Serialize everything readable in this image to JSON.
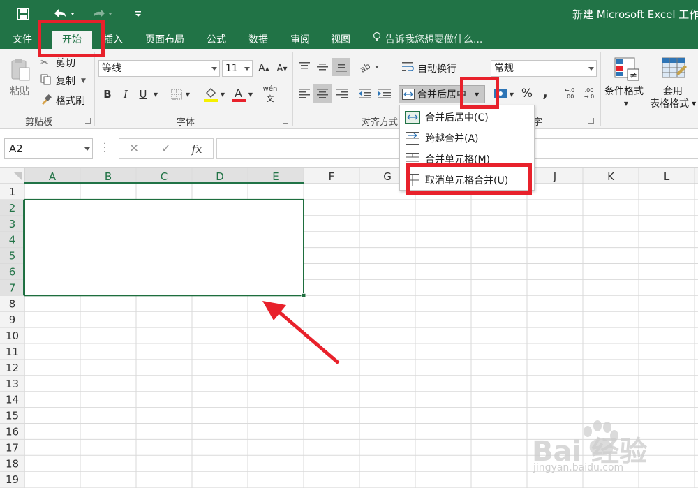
{
  "title_bar": {
    "title": "新建 Microsoft Excel 工作",
    "icons": [
      "save-icon",
      "undo-icon",
      "redo-icon",
      "customize-icon"
    ]
  },
  "tabs": [
    {
      "label": "文件",
      "active": false
    },
    {
      "label": "开始",
      "active": true
    },
    {
      "label": "插入",
      "active": false
    },
    {
      "label": "页面布局",
      "active": false
    },
    {
      "label": "公式",
      "active": false
    },
    {
      "label": "数据",
      "active": false
    },
    {
      "label": "审阅",
      "active": false
    },
    {
      "label": "视图",
      "active": false
    }
  ],
  "tell_me": "告诉我您想要做什么...",
  "ribbon": {
    "clipboard": {
      "paste": "粘贴",
      "cut": "剪切",
      "copy": "复制",
      "format_painter": "格式刷",
      "group_label": "剪贴板"
    },
    "font": {
      "font_name": "等线",
      "font_size": "11",
      "bold": "B",
      "italic": "I",
      "underline": "U",
      "group_label": "字体",
      "phonetic": "wén"
    },
    "alignment": {
      "wrap_text": "自动换行",
      "merge_center": "合并后居中",
      "group_label": "对齐方式"
    },
    "number": {
      "format": "常规",
      "percent": "%",
      "comma": ",",
      "group_label_partial": "字"
    },
    "styles": {
      "conditional_format": "条件格式",
      "table_format_line1": "套用",
      "table_format_line2": "表格格式"
    }
  },
  "formula_bar": {
    "name_box": "A2",
    "cancel": "✕",
    "enter": "✓",
    "fx": "fx",
    "formula": ""
  },
  "grid": {
    "columns": [
      "A",
      "B",
      "C",
      "D",
      "E",
      "F",
      "G",
      "H",
      "I",
      "J",
      "K",
      "L"
    ],
    "rows": [
      "1",
      "2",
      "3",
      "4",
      "5",
      "6",
      "7",
      "8",
      "9",
      "10",
      "11",
      "12",
      "13",
      "14",
      "15",
      "16",
      "17",
      "18",
      "19"
    ],
    "selected_range": "A2:E7"
  },
  "merge_menu": [
    {
      "label": "合并后居中(C)",
      "icon": "merge-center-icon"
    },
    {
      "label": "跨越合并(A)",
      "icon": "merge-across-icon"
    },
    {
      "label": "合并单元格(M)",
      "icon": "merge-cells-icon"
    },
    {
      "label": "取消单元格合并(U)",
      "icon": "unmerge-cells-icon"
    }
  ],
  "watermark": {
    "logo": "Bai 经验",
    "url": "jingyan.baidu.com"
  },
  "colors": {
    "excel_green": "#217346",
    "highlight_red": "#e8212b",
    "selection_green": "#1e6e3e"
  }
}
